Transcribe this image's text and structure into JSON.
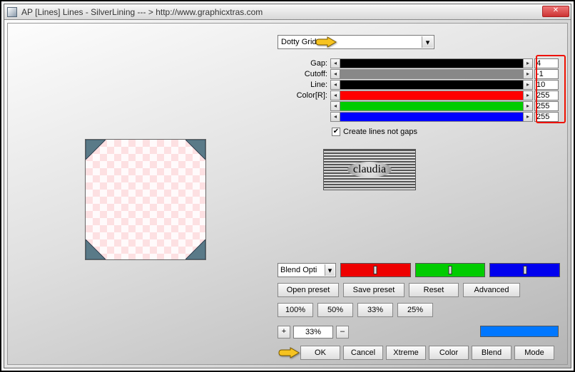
{
  "title": "AP [Lines]  Lines - SilverLining   --- >  http://www.graphicxtras.com",
  "preset_dropdown": "Dotty Grid",
  "sliders": {
    "gap": {
      "label": "Gap:",
      "value": "4",
      "fill": "#000"
    },
    "cutoff": {
      "label": "Cutoff:",
      "value": "-1",
      "fill": "#888"
    },
    "line": {
      "label": "Line:",
      "value": "10",
      "fill": "#000"
    },
    "colorR": {
      "label": "Color[R]:",
      "value": "255",
      "fill": "#f00"
    },
    "colorG": {
      "label": "",
      "value": "255",
      "fill": "#0c0"
    },
    "colorB": {
      "label": "",
      "value": "255",
      "fill": "#00f"
    }
  },
  "checkbox": {
    "checked": true,
    "label": "Create lines not gaps"
  },
  "logo_text": "claudia",
  "blend_dropdown": "Blend Opti",
  "buttons": {
    "open_preset": "Open preset",
    "save_preset": "Save preset",
    "reset": "Reset",
    "advanced": "Advanced",
    "z100": "100%",
    "z50": "50%",
    "z33": "33%",
    "z25": "25%",
    "ok": "OK",
    "cancel": "Cancel",
    "xtreme": "Xtreme",
    "color": "Color",
    "blend": "Blend",
    "mode": "Mode"
  },
  "zoom": {
    "plus": "+",
    "value": "33%",
    "minus": "–"
  }
}
